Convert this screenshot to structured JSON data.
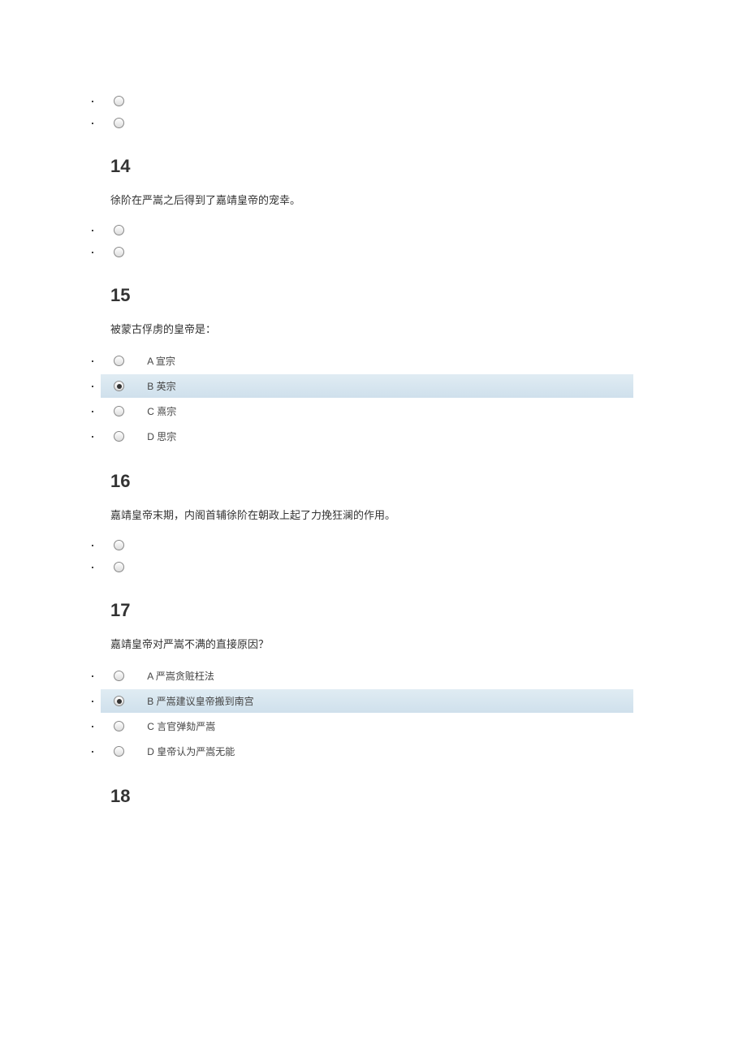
{
  "questions": [
    {
      "number": "",
      "text": "",
      "options": [
        {
          "letter": "",
          "text": "",
          "selected": false
        },
        {
          "letter": "",
          "text": "",
          "selected": false
        }
      ]
    },
    {
      "number": "14",
      "text": "徐阶在严嵩之后得到了嘉靖皇帝的宠幸。",
      "options": [
        {
          "letter": "",
          "text": "",
          "selected": false
        },
        {
          "letter": "",
          "text": "",
          "selected": false
        }
      ]
    },
    {
      "number": "15",
      "text": "被蒙古俘虏的皇帝是：",
      "options": [
        {
          "letter": "A",
          "text": "宣宗",
          "selected": false
        },
        {
          "letter": "B",
          "text": "英宗",
          "selected": true
        },
        {
          "letter": "C",
          "text": "熹宗",
          "selected": false
        },
        {
          "letter": "D",
          "text": "思宗",
          "selected": false
        }
      ]
    },
    {
      "number": "16",
      "text": "嘉靖皇帝末期，内阁首辅徐阶在朝政上起了力挽狂澜的作用。",
      "options": [
        {
          "letter": "",
          "text": "",
          "selected": false
        },
        {
          "letter": "",
          "text": "",
          "selected": false
        }
      ]
    },
    {
      "number": "17",
      "text": "嘉靖皇帝对严嵩不满的直接原因？",
      "options": [
        {
          "letter": "A",
          "text": "严嵩贪赃枉法",
          "selected": false
        },
        {
          "letter": "B",
          "text": "严嵩建议皇帝搬到南宫",
          "selected": true
        },
        {
          "letter": "C",
          "text": "言官弹劾严嵩",
          "selected": false
        },
        {
          "letter": "D",
          "text": "皇帝认为严嵩无能",
          "selected": false
        }
      ]
    },
    {
      "number": "18",
      "text": "",
      "options": []
    }
  ]
}
